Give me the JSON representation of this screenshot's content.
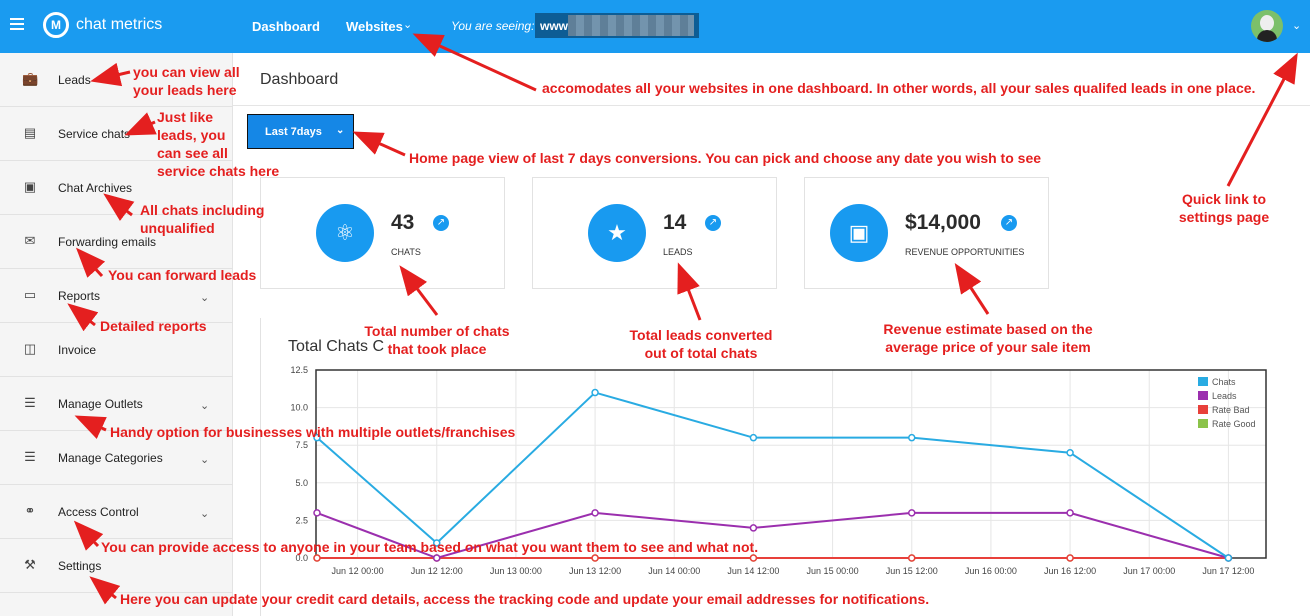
{
  "header": {
    "brand": "chat metrics",
    "logo_letters": "M",
    "nav_dashboard": "Dashboard",
    "nav_websites": "Websites",
    "seeing_label": "You are seeing:",
    "site_prefix": "www."
  },
  "sidebar": {
    "items": [
      {
        "label": "Leads",
        "icon": "briefcase-icon"
      },
      {
        "label": "Service chats",
        "icon": "chat-list-icon"
      },
      {
        "label": "Chat Archives",
        "icon": "chat-archive-icon"
      },
      {
        "label": "Forwarding emails",
        "icon": "envelope-icon"
      },
      {
        "label": "Reports",
        "icon": "monitor-icon"
      },
      {
        "label": "Invoice",
        "icon": "cash-icon"
      },
      {
        "label": "Manage Outlets",
        "icon": "stack-icon"
      },
      {
        "label": "Manage Categories",
        "icon": "stack-icon"
      },
      {
        "label": "Access Control",
        "icon": "users-icon"
      },
      {
        "label": "Settings",
        "icon": "wrench-icon"
      }
    ]
  },
  "main": {
    "page_title": "Dashboard",
    "range_label": "Last 7days",
    "stats": [
      {
        "value": "43",
        "caption": "CHATS",
        "icon": "chat-bubbles-icon"
      },
      {
        "value": "14",
        "caption": "LEADS",
        "icon": "star-icon"
      },
      {
        "value": "$14,000",
        "caption": "REVENUE OPPORTUNITIES",
        "icon": "money-icon"
      }
    ],
    "chart_title": "Total Chats C"
  },
  "chart_data": {
    "type": "line",
    "title": "Total Chats C",
    "x": [
      "Jun 12 00:00",
      "Jun 12 12:00",
      "Jun 13 00:00",
      "Jun 13 12:00",
      "Jun 14 00:00",
      "Jun 14 12:00",
      "Jun 15 00:00",
      "Jun 15 12:00",
      "Jun 16 00:00",
      "Jun 16 12:00",
      "Jun 17 00:00",
      "Jun 17 12:00"
    ],
    "y_ticks": [
      "0.0",
      "2.5",
      "5.0",
      "7.5",
      "10.0",
      "12.5"
    ],
    "ylim": [
      0,
      12.5
    ],
    "grid": true,
    "legend": "top-right",
    "series": [
      {
        "name": "Chats",
        "color": "#29abe2",
        "points": [
          [
            -0.05,
            8
          ],
          [
            1,
            1
          ],
          [
            3,
            11
          ],
          [
            5,
            8
          ],
          [
            7,
            8
          ],
          [
            9,
            7
          ],
          [
            11,
            0
          ]
        ]
      },
      {
        "name": "Leads",
        "color": "#9b2fae",
        "points": [
          [
            -0.05,
            3
          ],
          [
            1,
            0
          ],
          [
            3,
            3
          ],
          [
            5,
            2
          ],
          [
            7,
            3
          ],
          [
            9,
            3
          ],
          [
            11,
            0
          ]
        ]
      },
      {
        "name": "Rate Bad",
        "color": "#e8403a",
        "points": [
          [
            -0.05,
            0
          ],
          [
            1,
            0
          ],
          [
            3,
            0
          ],
          [
            5,
            0
          ],
          [
            7,
            0
          ],
          [
            9,
            0
          ],
          [
            11,
            0
          ]
        ]
      },
      {
        "name": "Rate Good",
        "color": "#8bc34a",
        "points": [
          [
            -0.05,
            0
          ],
          [
            1,
            0
          ],
          [
            3,
            0
          ],
          [
            5,
            0
          ],
          [
            7,
            0
          ],
          [
            9,
            0
          ],
          [
            11,
            0
          ]
        ]
      }
    ]
  },
  "annotations": {
    "leads": "you can view all\nyour leads here",
    "service": "Just like\nleads, you\ncan see all\nservice chats here",
    "archives": "All chats including\nunqualified",
    "forward": "You can forward leads",
    "reports": "Detailed reports",
    "outlets": "Handy option for businesses with multiple outlets/franchises",
    "access": "You can provide access to anyone in your team based on what you want them to see and what not.",
    "settings": "Here you can update your credit card details, access the tracking code and update your email addresses for notifications.",
    "websites": "accomodates all your websites in one dashboard. In other words, all your sales qualifed leads in one place.",
    "range": "Home page view of last 7 days conversions. You can pick and choose any date you wish to see",
    "chats": "Total number of chats\nthat took place",
    "leads_card": "Total leads converted\nout of total chats",
    "revenue": "Revenue estimate based on the\naverage price of your sale item",
    "quick": "Quick link to\nsettings page"
  },
  "colors": {
    "brand": "#1a9bf0",
    "annotation": "#e41f1f"
  }
}
